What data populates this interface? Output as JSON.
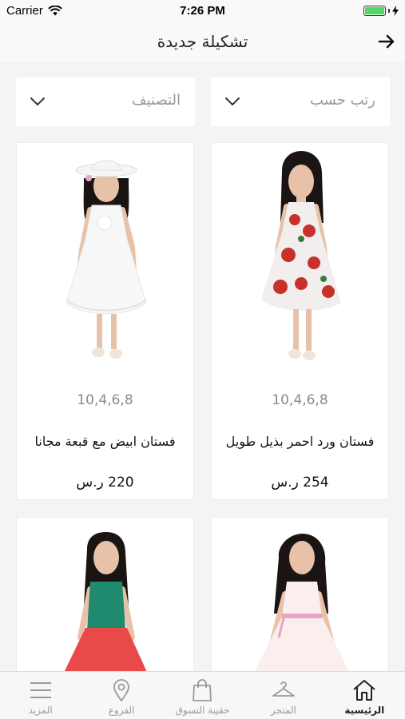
{
  "status_bar": {
    "carrier": "Carrier",
    "time": "7:26 PM",
    "battery_level": 1.0,
    "battery_color": "#4cd964"
  },
  "header": {
    "title": "تشكيلة جديدة",
    "back_icon": "arrow-right-icon"
  },
  "filters": {
    "sort_label": "رتب حسب",
    "category_label": "التصنيف",
    "dropdown_icon": "chevron-down-icon"
  },
  "products": [
    {
      "sizes": "10,4,6,8",
      "name": "فستان ورد احمر بذيل طويل",
      "price": "254 ر.س",
      "dress_color": "#f3eeee",
      "accent_color": "#c9302c"
    },
    {
      "sizes": "10,4,6,8",
      "name": "فستان ابيض مع قبعة مجانا",
      "price": "220 ر.س",
      "dress_color": "#f7f7f7",
      "accent_color": "#ffffff"
    },
    {
      "dress_color": "#fbeeee",
      "accent_color": "#e6a7c4"
    },
    {
      "dress_color": "#1f8a6e",
      "accent_color": "#e84a4a"
    }
  ],
  "tab_bar": {
    "items": [
      {
        "label": "الرئيسية",
        "icon": "home-icon",
        "active": true
      },
      {
        "label": "المتجر",
        "icon": "hanger-icon",
        "active": false
      },
      {
        "label": "حقيبة التسوق",
        "icon": "shopping-bag-icon",
        "active": false
      },
      {
        "label": "الفروع",
        "icon": "location-pin-icon",
        "active": false
      },
      {
        "label": "المزيد",
        "icon": "menu-icon",
        "active": false
      }
    ]
  },
  "colors": {
    "background": "#f4f4f4",
    "card": "#ffffff",
    "muted_text": "#9a9a9a",
    "active_tab": "#222222"
  }
}
